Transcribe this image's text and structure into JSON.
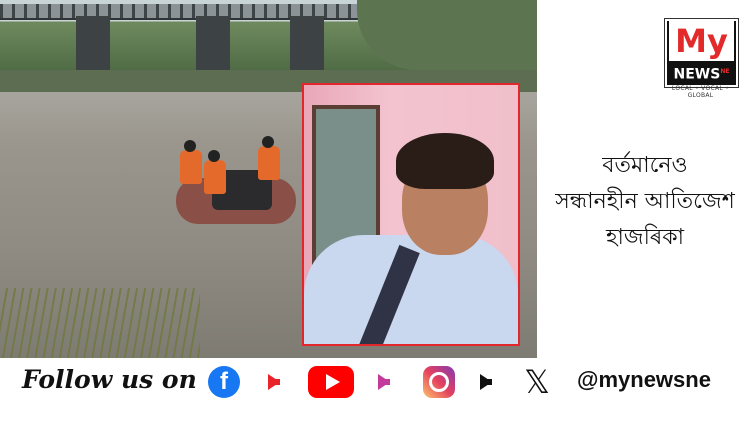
{
  "headline": {
    "line1": "বৰ্তমানেও",
    "line2": "সন্ধানহীন আতিজেশ",
    "line3": "হাজৰিকা"
  },
  "logo": {
    "brand_top": "My",
    "brand_bottom": "NEWS",
    "superscript": "NE",
    "tagline": "LOCAL • VOCAL • GLOBAL"
  },
  "footer": {
    "follow_text": "Follow us on",
    "handle": "@mynewsne",
    "icons": [
      "facebook-icon",
      "youtube-icon",
      "instagram-icon",
      "x-icon"
    ]
  },
  "colors": {
    "brand_red": "#e32a2a",
    "portrait_border": "#e3262b",
    "facebook": "#1877f2",
    "youtube": "#ff0000"
  }
}
